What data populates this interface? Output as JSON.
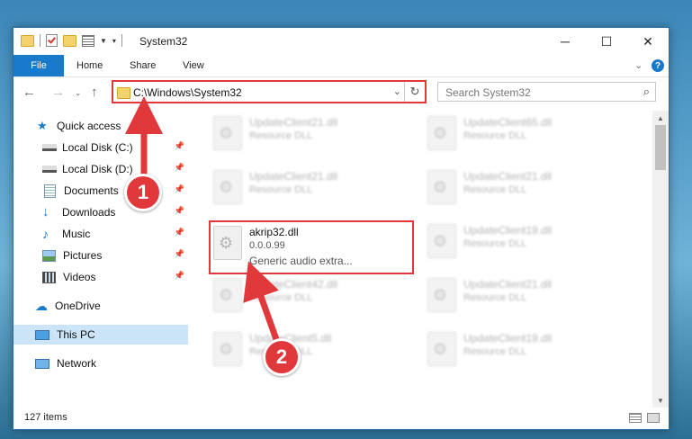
{
  "window": {
    "title": "System32"
  },
  "ribbon": {
    "file": "File",
    "home": "Home",
    "share": "Share",
    "view": "View",
    "help": "?"
  },
  "address": {
    "path": "C:\\Windows\\System32"
  },
  "search": {
    "placeholder": "Search System32"
  },
  "sidebar": {
    "items": [
      {
        "label": "Quick access",
        "icon": "star-icon"
      },
      {
        "label": "Local Disk (C:)",
        "icon": "drive-icon"
      },
      {
        "label": "Local Disk (D:)",
        "icon": "drive-icon"
      },
      {
        "label": "Documents",
        "icon": "documents-icon"
      },
      {
        "label": "Downloads",
        "icon": "downloads-icon"
      },
      {
        "label": "Music",
        "icon": "music-icon"
      },
      {
        "label": "Pictures",
        "icon": "pictures-icon"
      },
      {
        "label": "Videos",
        "icon": "videos-icon"
      },
      {
        "label": "OneDrive",
        "icon": "cloud-icon"
      },
      {
        "label": "This PC",
        "icon": "computer-icon"
      },
      {
        "label": "Network",
        "icon": "network-icon"
      }
    ]
  },
  "files": [
    {
      "name": "UpdateClient21.dll",
      "desc": "Resource DLL"
    },
    {
      "name": "UpdateClient65.dll",
      "desc": "Resource DLL"
    },
    {
      "name": "UpdateClient21.dll",
      "desc": "Resource DLL"
    },
    {
      "name": "UpdateClient21.dll",
      "desc": "Resource DLL"
    },
    {
      "name": "UpdateClient19.dll",
      "desc": "Resource DLL"
    },
    {
      "name": "UpdateClient42.dll",
      "desc": "Resource DLL"
    },
    {
      "name": "UpdateClient21.dll",
      "desc": "Resource DLL"
    },
    {
      "name": "UpdateClient5.dll",
      "desc": "Resource DLL"
    },
    {
      "name": "UpdateClient19.dll",
      "desc": "Resource DLL"
    }
  ],
  "highlighted_file": {
    "name": "akrip32.dll",
    "version": "0.0.0.99",
    "desc": "Generic audio extra..."
  },
  "status": {
    "count": "127 items"
  },
  "annotations": {
    "step1": "1",
    "step2": "2",
    "color": "#e1393b"
  }
}
